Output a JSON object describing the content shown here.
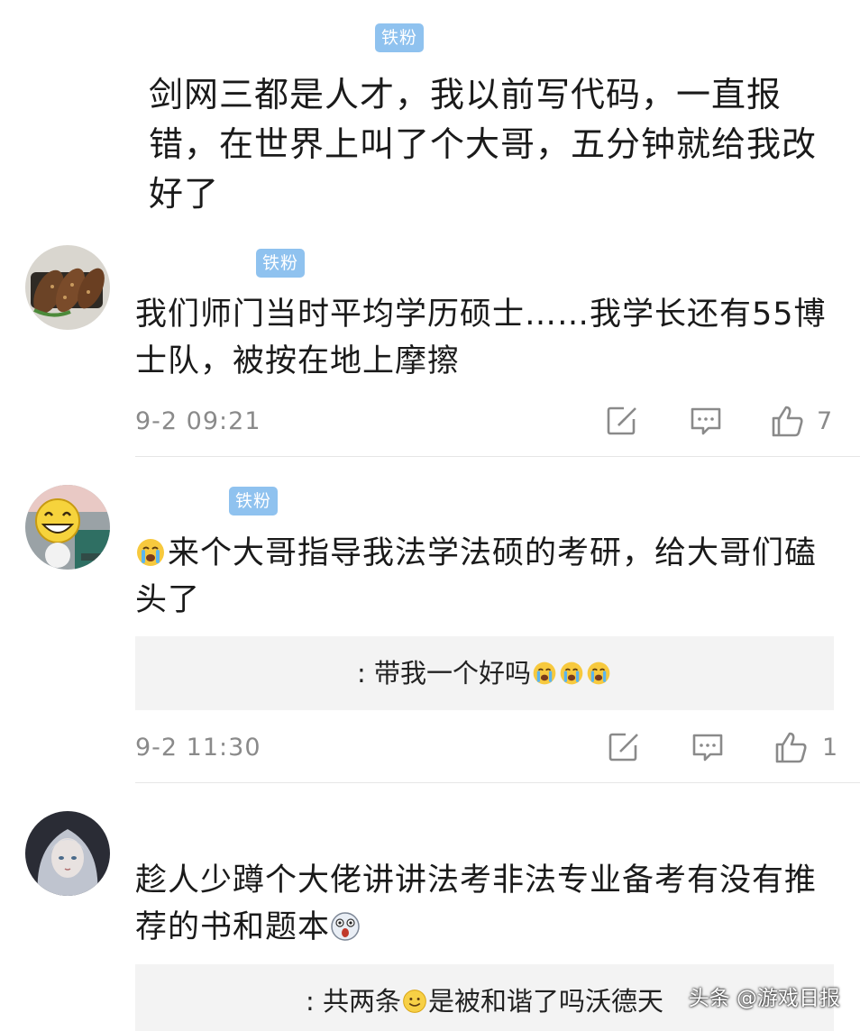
{
  "comments": [
    {
      "badge": "铁粉",
      "text": "剑网三都是人才，我以前写代码，一直报错，在世界上叫了个大哥，五分钟就给我改好了"
    },
    {
      "avatar": "food-avatar",
      "badge": "铁粉",
      "text": "我们师门当时平均学历硕士……我学长还有55博士队，被按在地上摩擦",
      "time": "9-2 09:21",
      "likes": "7"
    },
    {
      "avatar": "grin-emoji-avatar",
      "badge": "铁粉",
      "emoji": "crying-emoji",
      "text": "来个大哥指导我法学法硕的考研，给大哥们磕头了",
      "reply": ": 带我一个好吗",
      "reply_emoji": "crying-emoji",
      "time": "9-2 11:30",
      "likes": "1"
    },
    {
      "avatar": "anime-girl-avatar",
      "text": "趁人少蹲个大佬讲讲法考非法专业备考有没有推荐的书和题本",
      "text_emoji": "shocked-emoji",
      "reply_prefix": ": 共两条",
      "reply_emoji": "smile-emoji",
      "reply_suffix": "是被和谐了吗沃德天"
    }
  ],
  "icons": {
    "share": "edit-share-icon",
    "reply": "comment-icon",
    "like": "thumbs-up-icon"
  },
  "colors": {
    "badge": "#8fc2ef",
    "meta_text": "#8a8a8a",
    "reply_bg": "#f3f3f3"
  },
  "watermark": "头条 @游戏日报"
}
